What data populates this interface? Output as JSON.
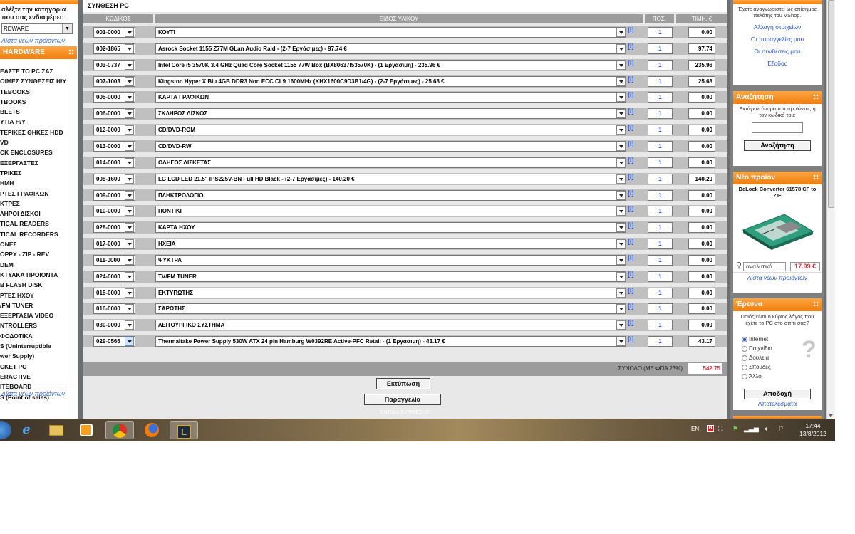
{
  "left": {
    "intro": "αλέξτε την κατηγορία που σας ενδιαφέρει:",
    "select_value": "RDWARE",
    "new_products_link": "Λίστα νέων προϊόντων",
    "box_title": "HARDWARE",
    "categories": [
      "ΕΑΣΤΕ ΤΟ PC ΣΑΣ",
      "ΟΙΜΕΣ ΣΥΝΘΕΣΕΙΣ Η/Υ",
      "TEBOOKS",
      "TBOOKS",
      "BLETS",
      "ΥΤΙΑ Η/Υ",
      "ΤΕΡΙΚΕΣ ΘΗΚΕΣ HDD",
      "VD",
      "CK ENCLOSURES",
      "ΕΞΕΡΓΑΣΤΕΣ",
      "ΤΡΙΚΕΣ",
      "ΗΜΗ",
      "ΡΤΕΣ ΓΡΑΦΙΚΩΝ",
      "ΚΤΡΕΣ",
      "ΛΗΡΟΙ ΔΙΣΚΟΙ",
      "TICAL READERS",
      "TICAL RECORDERS",
      "ΟΝΕΣ",
      "OPPY - ZIP - REV",
      "DEM",
      "ΚΤΥΑΚΑ ΠΡΟΙΟΝΤΑ",
      "B FLASH DISK",
      "ΡΤΕΣ ΗΧΟΥ",
      "/FM TUNER",
      "ΕΞΕΡΓΑΣΙΑ VIDEO",
      "NTROLLERS",
      "ΦΟΔΟΤΙΚΑ",
      "S (Uninterruptible",
      "wer Supply)",
      "CKET PC",
      "ERACTIVE",
      "ITEBOARD",
      "S (Point of sales)"
    ],
    "bottom_link": "Λίστα νέων προϊόντων"
  },
  "main": {
    "title": "ΣΥΝΘΕΣΗ PC",
    "headers": {
      "code": "ΚΩΔΙΚΟΣ",
      "item": "ΕΙΔΟΣ ΥΛΙΚΟΥ",
      "qty": "ΠΟΣ.",
      "price": "ΤΙΜΗ, €"
    },
    "info_label": "[i]",
    "rows": [
      {
        "code": "001-0000",
        "desc": "ΚΟΥΤΙ",
        "qty": "1",
        "price": "0.00"
      },
      {
        "code": "002-1865",
        "desc": "Asrock Socket 1155 Z77M GLan Audio Raid - (2-7 Εργάσιμες) - 97.74 €",
        "qty": "1",
        "price": "97.74"
      },
      {
        "code": "003-0737",
        "desc": "Intel Core i5 3570K 3.4 GHz Quad Core Socket 1155 77W Box (BX80637I53570K) - (1 Εργάσιμη) - 235.96 €",
        "qty": "1",
        "price": "235.96"
      },
      {
        "code": "007-1003",
        "desc": "Kingston Hyper X Blu 4GB DDR3 Non ECC CL9 1600MHz (KHX1600C9D3B1/4G) - (2-7 Εργάσιμες) - 25.68 €",
        "qty": "1",
        "price": "25.68"
      },
      {
        "code": "005-0000",
        "desc": "ΚΑΡΤΑ ΓΡΑΦΙΚΩΝ",
        "qty": "1",
        "price": "0.00"
      },
      {
        "code": "006-0000",
        "desc": "ΣΚΛΗΡΟΣ ΔΙΣΚΟΣ",
        "qty": "1",
        "price": "0.00"
      },
      {
        "code": "012-0000",
        "desc": "CD/DVD-ROM",
        "qty": "1",
        "price": "0.00"
      },
      {
        "code": "013-0000",
        "desc": "CD/DVD-RW",
        "qty": "1",
        "price": "0.00"
      },
      {
        "code": "014-0000",
        "desc": "ΟΔΗΓΟΣ ΔΙΣΚΕΤΑΣ",
        "qty": "1",
        "price": "0.00"
      },
      {
        "code": "008-1600",
        "desc": "LG LCD LED 21.5\" IPS225V-BN Full HD Black - (2-7 Εργάσιμες) - 140.20 €",
        "qty": "1",
        "price": "140.20"
      },
      {
        "code": "009-0000",
        "desc": "ΠΛΗΚΤΡΟΛΟΓΙΟ",
        "qty": "1",
        "price": "0.00"
      },
      {
        "code": "010-0000",
        "desc": "ΠΟΝΤΙΚΙ",
        "qty": "1",
        "price": "0.00"
      },
      {
        "code": "028-0000",
        "desc": "ΚΑΡΤΑ ΗΧΟΥ",
        "qty": "1",
        "price": "0.00"
      },
      {
        "code": "017-0000",
        "desc": "ΗΧΕΙΑ",
        "qty": "1",
        "price": "0.00"
      },
      {
        "code": "011-0000",
        "desc": "ΨΥΚΤΡΑ",
        "qty": "1",
        "price": "0.00"
      },
      {
        "code": "024-0000",
        "desc": "TV/FM TUNER",
        "qty": "1",
        "price": "0.00"
      },
      {
        "code": "015-0000",
        "desc": "ΕΚΤΥΠΩΤΗΣ",
        "qty": "1",
        "price": "0.00"
      },
      {
        "code": "016-0000",
        "desc": "ΣΑΡΩΤΗΣ",
        "qty": "1",
        "price": "0.00"
      },
      {
        "code": "030-0000",
        "desc": "ΛΕΙΤΟΥΡΓΙΚΟ ΣΥΣΤΗΜΑ",
        "qty": "1",
        "price": "0.00"
      },
      {
        "code": "029-0566",
        "desc": "Thermaltake Power Supply 530W ATX 24 pin Hamburg W0392RE Active-PFC Retail - (1 Εργάσιμη) - 43.17 €",
        "qty": "1",
        "price": "43.17"
      }
    ],
    "total_label": "ΣΥΝΟΛΟ (ΜΕ ΦΠΑ 23%)",
    "total_value": "542.75",
    "print_button": "Εκτύπωση",
    "order_button": "Παραγγελία",
    "name_label": "ΟΝΟΜΑ ΣΥΝΘΕΣΗΣ:"
  },
  "right": {
    "account_text": "Έχετε αναγνωριστεί ως επίσημος πελάτης του VShop.",
    "account_links": [
      "Αλλαγή στοιχείων",
      "Οι παραγγελίες μου",
      "Οι συνθέσεις μου",
      "Εξοδος"
    ],
    "search_title": "Αναζήτηση",
    "search_text": "Εισάγετε όνομα του προϊόντος ή τον κωδικό του:",
    "search_button": "Αναζήτηση",
    "new_title": "Νέο προϊόν",
    "new_name": "DeLock Converter 61578 CF to ZIF",
    "new_details": "αναλυτικά...",
    "new_price": "17.99 €",
    "new_list_link": "Λίστα νέων προϊόντων",
    "poll_title": "Έρευνα",
    "poll_question": "Ποιός είναι ο κύριος λόγος που έχετε το PC στο σπίτι σας?",
    "poll_options": [
      "Internet",
      "Παιχνίδια",
      "Δουλειά",
      "Σπουδές",
      "Άλλο"
    ],
    "poll_button": "Αποδοχή",
    "poll_results": "Αποτελέσματα"
  },
  "taskbar": {
    "lang": "EN",
    "time": "17:44",
    "date": "13/8/2012"
  },
  "colors": {
    "accent_orange": "#f07d0c",
    "link_blue": "#2a58c8",
    "total_red": "#d4303c"
  }
}
